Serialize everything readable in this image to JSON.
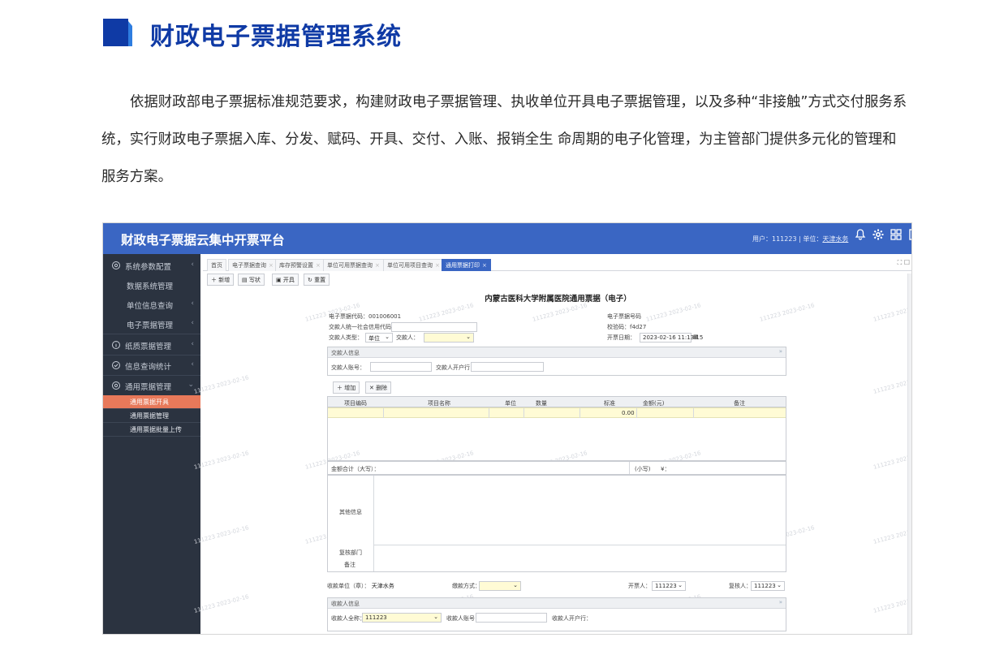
{
  "doc": {
    "title": "财政电子票据管理系统",
    "paragraph": "依据财政部电子票据标准规范要求，构建财政电子票据管理、执收单位开具电子票据管理，以及多种“非接触”方式交付服务系统，实行财政电子票据入库、分发、赋码、开具、交付、入账、报销全生 命周期的电子化管理，为主管部门提供多元化的管理和服务方案。"
  },
  "colors": {
    "brand": "#0f3aa5",
    "topbar": "#3a66c3",
    "sidebar": "#2b3340",
    "active": "#e8795a"
  },
  "app": {
    "title": "财政电子票据云集中开票平台",
    "user_label": "用户：",
    "user_value": "111223",
    "unit_label": "单位：",
    "unit_value": "天津水务"
  },
  "sidebar": {
    "items": [
      {
        "label": "系统参数配置",
        "icon": "settings-icon"
      },
      {
        "label": "数据系统管理"
      },
      {
        "label": "单位信息查询"
      },
      {
        "label": "电子票据管理"
      },
      {
        "label": "纸质票据管理",
        "icon": "info-icon"
      },
      {
        "label": "信息查询统计",
        "icon": "check-icon"
      },
      {
        "label": "通用票据管理",
        "icon": "settings-icon"
      }
    ],
    "subitems": [
      "通用票据开具",
      "通用票据管理",
      "通用票据批量上传"
    ]
  },
  "tabs": [
    "首页",
    "电子票据查询",
    "库存预警设置",
    "单位可用票据查询",
    "单位可用项目查询",
    "通用票据打印"
  ],
  "toolbar": [
    "新增",
    "写状",
    "开具",
    "重置"
  ],
  "form": {
    "title": "内蒙古医科大学附属医院通用票据（电子）",
    "code_label": "电子票据代码：",
    "code_value": "001006001",
    "payer_id_label": "交款人统一社会信用代码：",
    "payer_type_label": "交款人类型：",
    "payer_type_value": "单位",
    "payer_name_label": "交款人：",
    "number_label": "电子票据号码",
    "check_label": "校验码：",
    "check_value": "f4d27",
    "date_label": "开票日期：",
    "date_value": "2023-02-16 11:13:15",
    "payer_panel_title": "交款人信息",
    "payer_account_label": "交款人账号：",
    "payer_bank_label": "交款人开户行：",
    "add_label": "增加",
    "delete_label": "删除",
    "grid_headers": [
      "项目编码",
      "项目名称",
      "单位",
      "数量",
      "标准",
      "金额(元)",
      "备注"
    ],
    "total_value": "0.00",
    "sum_label": "金额合计（大写）：",
    "small_label": "(小写)",
    "small_value": "¥：",
    "other_info_label": "其他信息",
    "org_label": "复核部门",
    "remark_label": "备注",
    "payee_unit_label": "收款单位（章）：",
    "payee_unit_value": "天津水务",
    "pay_method_label": "缴款方式：",
    "issuer_label": "开票人：",
    "issuer_value": "111223",
    "reviewer_label": "复核人：",
    "reviewer_value": "111223",
    "payee_panel_title": "收款人信息",
    "payee_name_label": "收款人全称：",
    "payee_name_value": "111223",
    "payee_account_label": "收款人账号：",
    "payee_bank_label": "收款人开户行："
  },
  "watermark": "111223 2023-02-16"
}
